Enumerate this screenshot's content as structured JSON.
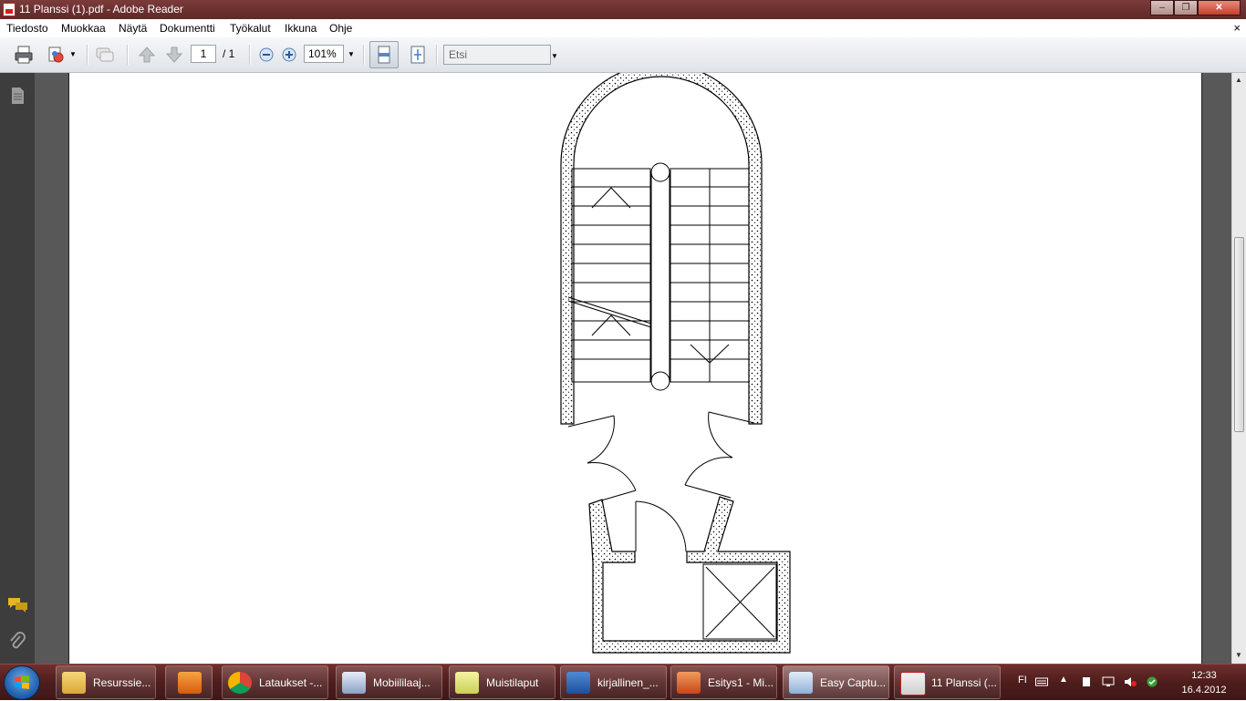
{
  "window": {
    "title": "11 Planssi (1).pdf - Adobe Reader"
  },
  "menu": {
    "items": [
      "Tiedosto",
      "Muokkaa",
      "Näytä",
      "Dokumentti",
      "Työkalut",
      "Ikkuna",
      "Ohje"
    ],
    "doc_close": "×"
  },
  "toolbar": {
    "page_current": "1",
    "page_total": "/ 1",
    "zoom": "101%",
    "search_placeholder": "Etsi"
  },
  "taskbar": {
    "items": [
      {
        "label": "Resurssie...",
        "icon": "folder-icon"
      },
      {
        "label": "",
        "icon": "media-player-icon"
      },
      {
        "label": "Lataukset -...",
        "icon": "chrome-icon"
      },
      {
        "label": "Mobiililaaj...",
        "icon": "app-icon"
      },
      {
        "label": "Muistilaput",
        "icon": "sticky-notes-icon"
      },
      {
        "label": "kirjallinen_...",
        "icon": "word-icon"
      },
      {
        "label": "Esitys1 - Mi...",
        "icon": "powerpoint-icon"
      },
      {
        "label": "Easy Captu...",
        "icon": "capture-icon"
      },
      {
        "label": "11 Planssi (...",
        "icon": "pdf-icon"
      }
    ],
    "lang": "FI",
    "time": "12:33",
    "date": "16.4.2012"
  }
}
